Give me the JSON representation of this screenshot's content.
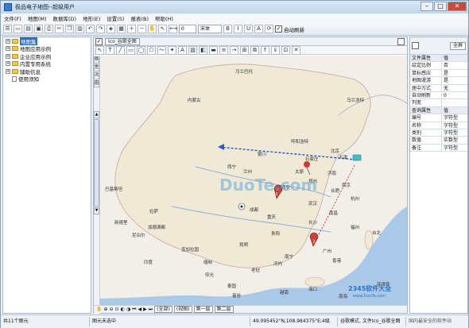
{
  "window": {
    "title": "极品电子地图--超级用户"
  },
  "menu": [
    "文件(F)",
    "地图(M)",
    "数据库(D)",
    "地形(E)",
    "设置(S)",
    "报表(B)",
    "帮助(H)"
  ],
  "toolbar": {
    "zoom_value": "0",
    "font_value": "宋体",
    "auto_refresh_label": "自动刷新",
    "auto_refresh_checked": true
  },
  "sidebar": {
    "items": [
      {
        "label": "地图集",
        "selected": true,
        "expander": "+"
      },
      {
        "label": "地图应用示例",
        "expander": "+"
      },
      {
        "label": "企业应用示例",
        "expander": "+"
      },
      {
        "label": "内置专用系统",
        "expander": "+"
      },
      {
        "label": "辅助信息",
        "expander": "+"
      },
      {
        "label": "使用须知",
        "expander": ""
      }
    ]
  },
  "map": {
    "tab_label": "Ico_谷歌全图",
    "vtools": [
      "移",
      "查",
      "点",
      "图"
    ],
    "bottom_tabs": [
      "(全部)",
      "(视图)",
      "第一层",
      "第二层"
    ],
    "labels": {
      "neimenggu": "内蒙古",
      "wulanhaote": "乌兰浩特",
      "huhehaote": "呼和浩特",
      "beijing": "北京",
      "tianjin": "天津",
      "shijiazhuang": "石家庄",
      "jinan": "济南",
      "taiyuan": "太原",
      "xian": "西安",
      "zhengzhou": "郑州",
      "chengdu": "成都",
      "chongqing": "重庆",
      "wuhan": "武汉",
      "hangzhou": "杭州",
      "changsha": "长沙",
      "guiyang": "贵阳",
      "kunming": "昆明",
      "guangzhou": "广州",
      "nanning": "南宁",
      "fuzhou": "福州",
      "taipei": "台北",
      "lhasa": "拉萨",
      "yinchuan": "银川",
      "lanzhou": "兰州",
      "xining": "西宁",
      "hefei": "合肥",
      "nanjing": "南京",
      "nanchang": "南昌",
      "mongolia_ub": "乌兰巴托",
      "india": "印度",
      "nepal": "尼泊尔",
      "bangladesh": "孟加拉国",
      "myanmar": "缅甸",
      "thailand": "泰国",
      "vietnam": "越南",
      "laos": "老挝",
      "philippines": "菲律宾",
      "south_china_sea": "南海",
      "pakistan": "巴基斯坦",
      "delhi": "新德里",
      "kathmandu": "加德满都",
      "yangon": "仰光",
      "bangkok": "曼谷",
      "hanoi": "河内",
      "haikou": "海口",
      "hongkong": "香港"
    },
    "markers": [
      "1",
      "2"
    ]
  },
  "watermark": {
    "main": "DuoTe.com",
    "corner": "2345软件大全",
    "corner_url": "www.DuoTe.com",
    "footer": "国内最安全的软件站"
  },
  "properties": {
    "header": {
      "key": "文件属性",
      "value": "值"
    },
    "rows": [
      {
        "k": "绽定比例",
        "v": "否"
      },
      {
        "k": "鼠标感应",
        "v": "是"
      },
      {
        "k": "地图漫游",
        "v": "是"
      },
      {
        "k": "居中方式",
        "v": "无"
      },
      {
        "k": "自动刷新",
        "v": "0"
      },
      {
        "k": "列宽",
        "v": ""
      }
    ],
    "query_header": {
      "key": "查询属性",
      "value": "值"
    },
    "query_rows": [
      {
        "k": "编号",
        "v": "字符型"
      },
      {
        "k": "名称",
        "v": "字符型"
      },
      {
        "k": "类别",
        "v": "字符型"
      },
      {
        "k": "数值",
        "v": "实数型"
      },
      {
        "k": "备注",
        "v": "字符型"
      }
    ],
    "full_label": "全屏"
  },
  "status": {
    "count": "共11个图元",
    "selection": "图元未选中",
    "coords": "49.095452°N,108.984375°E;4级",
    "mode": "谷歌模式, 文件Ico_谷歌全图"
  },
  "colors": {
    "selected": "#2f6cc6",
    "land": "#f2efe8",
    "water": "#aac8e8",
    "marker": "#c8453c",
    "route_blue": "#2b56d6",
    "route_red": "#d23a3a"
  }
}
